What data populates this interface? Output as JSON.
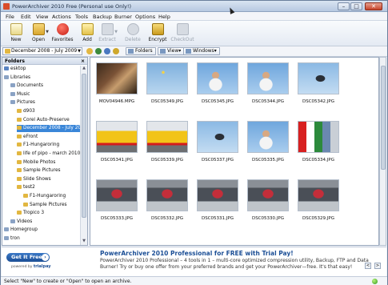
{
  "window": {
    "title": "PowerArchiver 2010 Free (Personal use Only!)",
    "controls": [
      "–",
      "□",
      "✕"
    ]
  },
  "menu": [
    "File",
    "Edit",
    "View",
    "Actions",
    "Tools",
    "Backup",
    "Burner",
    "Options",
    "Help"
  ],
  "toolbar": {
    "buttons": [
      {
        "label": "New",
        "icon": "new-icon",
        "enabled": true
      },
      {
        "label": "Open",
        "icon": "open-folder-icon",
        "enabled": true,
        "dropdown": true
      },
      {
        "label": "Favorites",
        "icon": "heart-icon",
        "enabled": true
      },
      {
        "label": "Add",
        "icon": "add-files-icon",
        "enabled": true
      },
      {
        "label": "Extract",
        "icon": "extract-icon",
        "enabled": false,
        "dropdown": true
      },
      {
        "label": "Delete",
        "icon": "delete-icon",
        "enabled": false
      },
      {
        "label": "Encrypt",
        "icon": "lock-icon",
        "enabled": true
      },
      {
        "label": "CheckOut",
        "icon": "checkout-icon",
        "enabled": false
      }
    ]
  },
  "addressbar": {
    "path": "December 2008 - July 2009",
    "folders_label": "Folders",
    "view_label": "View",
    "windows_label": "Windows"
  },
  "folders": {
    "title": "Folders",
    "close": "×",
    "items": [
      {
        "label": "esktop",
        "indent": 0,
        "icon": "desktop"
      },
      {
        "label": "Libraries",
        "indent": 0,
        "icon": "lib"
      },
      {
        "label": "Documents",
        "indent": 1,
        "icon": "lib"
      },
      {
        "label": "Music",
        "indent": 1,
        "icon": "lib"
      },
      {
        "label": "Pictures",
        "indent": 1,
        "icon": "lib"
      },
      {
        "label": "d903",
        "indent": 2,
        "icon": "folder"
      },
      {
        "label": "Corel Auto-Preserve",
        "indent": 2,
        "icon": "folder"
      },
      {
        "label": "December 2008 - July 2009",
        "indent": 2,
        "icon": "folder",
        "selected": true
      },
      {
        "label": "eFront",
        "indent": 2,
        "icon": "folder"
      },
      {
        "label": "F1-Hungaroring",
        "indent": 2,
        "icon": "folder"
      },
      {
        "label": "life of pipo - march 2010",
        "indent": 2,
        "icon": "folder"
      },
      {
        "label": "Mobile Photos",
        "indent": 2,
        "icon": "folder"
      },
      {
        "label": "Sample Pictures",
        "indent": 2,
        "icon": "folder"
      },
      {
        "label": "Slide Shows",
        "indent": 2,
        "icon": "folder"
      },
      {
        "label": "test2",
        "indent": 2,
        "icon": "folder"
      },
      {
        "label": "F1-Hungaroring",
        "indent": 3,
        "icon": "folder"
      },
      {
        "label": "Sample Pictures",
        "indent": 3,
        "icon": "folder"
      },
      {
        "label": "Tropico 3",
        "indent": 2,
        "icon": "folder"
      },
      {
        "label": "Videos",
        "indent": 1,
        "icon": "lib"
      },
      {
        "label": "Homegroup",
        "indent": 0,
        "icon": "lib"
      },
      {
        "label": "tron",
        "indent": 0,
        "icon": "lib"
      }
    ]
  },
  "thumbnails": [
    {
      "name": "MOV04946.MPG",
      "scene": "family"
    },
    {
      "name": "DSC05349.JPG",
      "scene": "sky-balloon"
    },
    {
      "name": "DSC05345.JPG",
      "scene": "people-sky"
    },
    {
      "name": "DSC05344.JPG",
      "scene": "people-sky"
    },
    {
      "name": "DSC05342.JPG",
      "scene": "helicopter-sky"
    },
    {
      "name": "DSC05341.JPG",
      "scene": "dhl-truck"
    },
    {
      "name": "DSC05339.JPG",
      "scene": "dhl-truck"
    },
    {
      "name": "DSC05337.JPG",
      "scene": "helicopter-sky"
    },
    {
      "name": "DSC05335.JPG",
      "scene": "people-sky"
    },
    {
      "name": "DSC05334.JPG",
      "scene": "crowd-flags"
    },
    {
      "name": "DSC05333.JPG",
      "scene": "track-screen"
    },
    {
      "name": "DSC05332.JPG",
      "scene": "track-screen"
    },
    {
      "name": "DSC05331.JPG",
      "scene": "track-screen"
    },
    {
      "name": "DSC05330.JPG",
      "scene": "track-screen"
    },
    {
      "name": "DSC05329.JPG",
      "scene": "track-screen"
    }
  ],
  "ad": {
    "button_label": "Get It Free",
    "powered_by": "powered by",
    "brand": "trialpay",
    "title": "PowerArchiver 2010 Professional for FREE with Trial Pay!",
    "body": "PowerArchiver 2010 Professional – 4 tools in 1 – multi-core optimized compression utility, Backup, FTP and Data Burner! Try or buy one offer from your preferred brands and get your PowerArchiver—free. It's that easy!",
    "prev": "<",
    "next": ">"
  },
  "status": {
    "text": "Select \"New\" to create or \"Open\" to open an archive."
  },
  "colors": {
    "selection": "#3a86d8",
    "accent": "#1c4f96",
    "status_led": "#2e9a1c"
  }
}
